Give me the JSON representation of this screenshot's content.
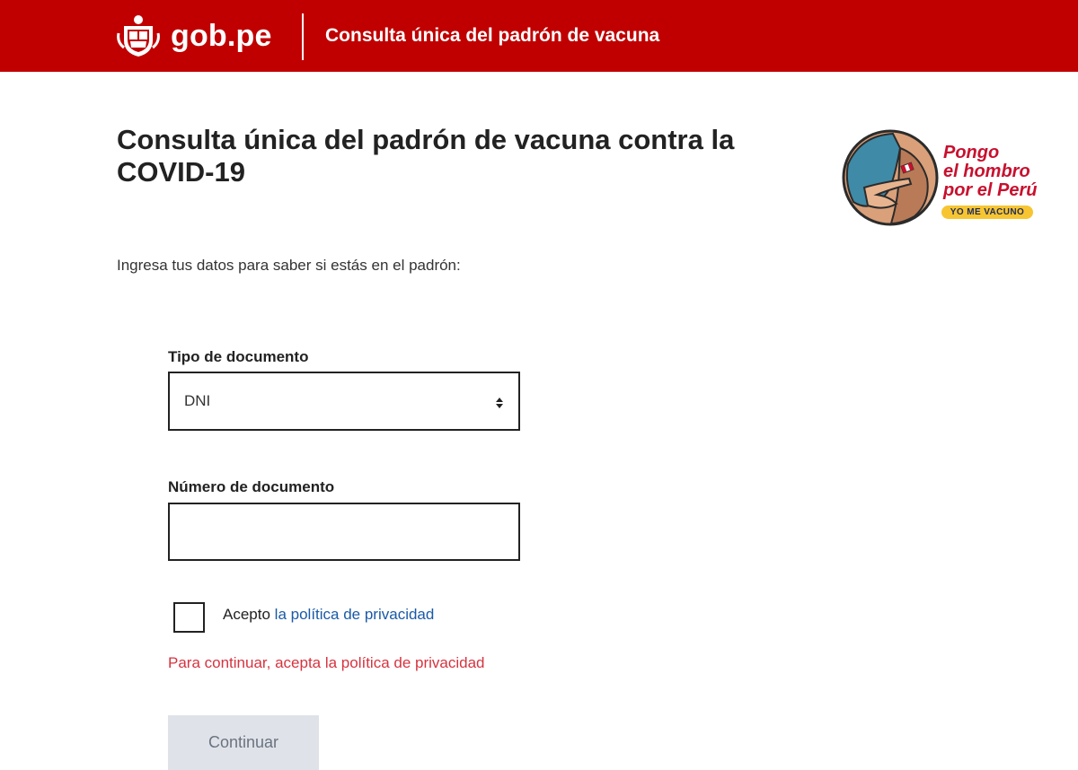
{
  "header": {
    "brand": "gob.pe",
    "title": "Consulta única del padrón de vacuna",
    "background_color": "#c00000"
  },
  "main": {
    "title": "Consulta única del padrón de vacuna contra la COVID-19",
    "intro": "Ingresa tus datos para saber si estás en el padrón:"
  },
  "badge": {
    "line1": "Pongo",
    "line2": "el hombro",
    "line3": "por el Perú",
    "tag": "YO ME VACUNO"
  },
  "form": {
    "document_type_label": "Tipo de documento",
    "document_type_value": "DNI",
    "document_number_label": "Número de documento",
    "document_number_value": "",
    "privacy_prefix": "Acepto",
    "privacy_link": "la política de privacidad",
    "privacy_checked": false,
    "error": "Para continuar, acepta la política de privacidad",
    "submit_label": "Continuar",
    "submit_disabled": true
  },
  "colors": {
    "accent_red": "#c00000",
    "link_blue": "#1a5aa6",
    "error_red": "#d6333f",
    "disabled_button": "#dfe3e9"
  },
  "icons": {
    "brand": "peru-coat-of-arms-icon",
    "select": "sort-arrows-icon",
    "badge": "vaccine-shoulder-illustration"
  }
}
